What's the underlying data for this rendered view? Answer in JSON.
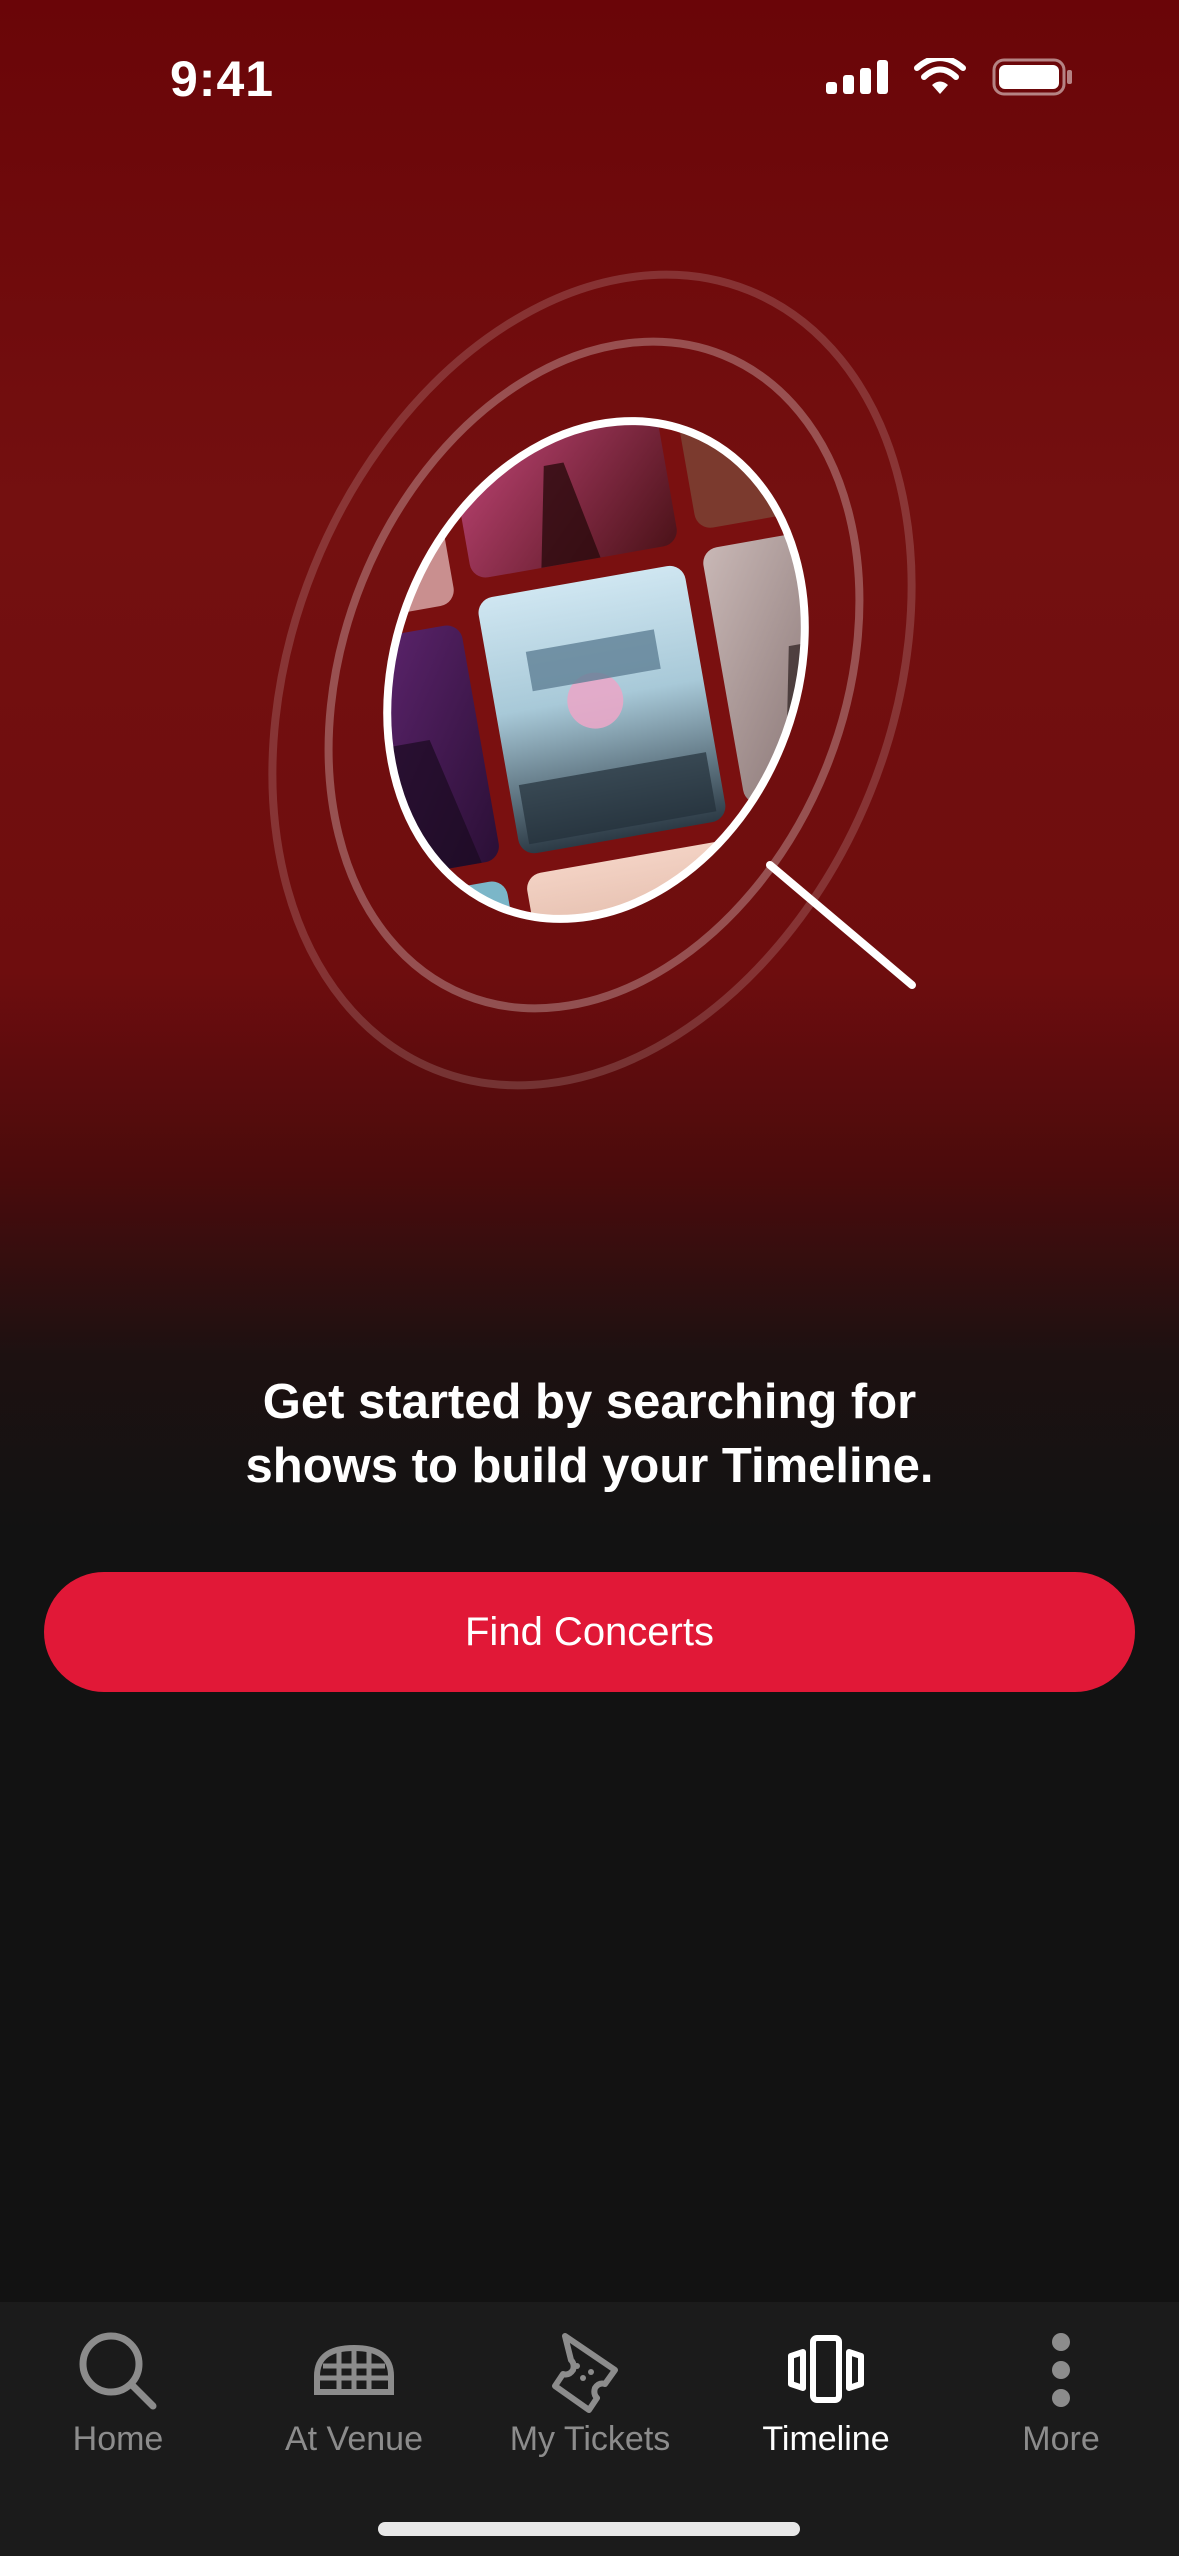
{
  "status_bar": {
    "time": "9:41"
  },
  "onboarding": {
    "line1": "Get started by searching for",
    "line2": "shows to build your Timeline.",
    "cta_label": "Find Concerts"
  },
  "tabs": [
    {
      "label": "Home",
      "icon": "search-icon",
      "active": false
    },
    {
      "label": "At Venue",
      "icon": "venue-icon",
      "active": false
    },
    {
      "label": "My Tickets",
      "icon": "ticket-icon",
      "active": false
    },
    {
      "label": "Timeline",
      "icon": "timeline-icon",
      "active": true
    },
    {
      "label": "More",
      "icon": "more-icon",
      "active": false
    }
  ],
  "colors": {
    "accent": "#e11837",
    "background": "#121212",
    "hero_red": "#741010"
  }
}
